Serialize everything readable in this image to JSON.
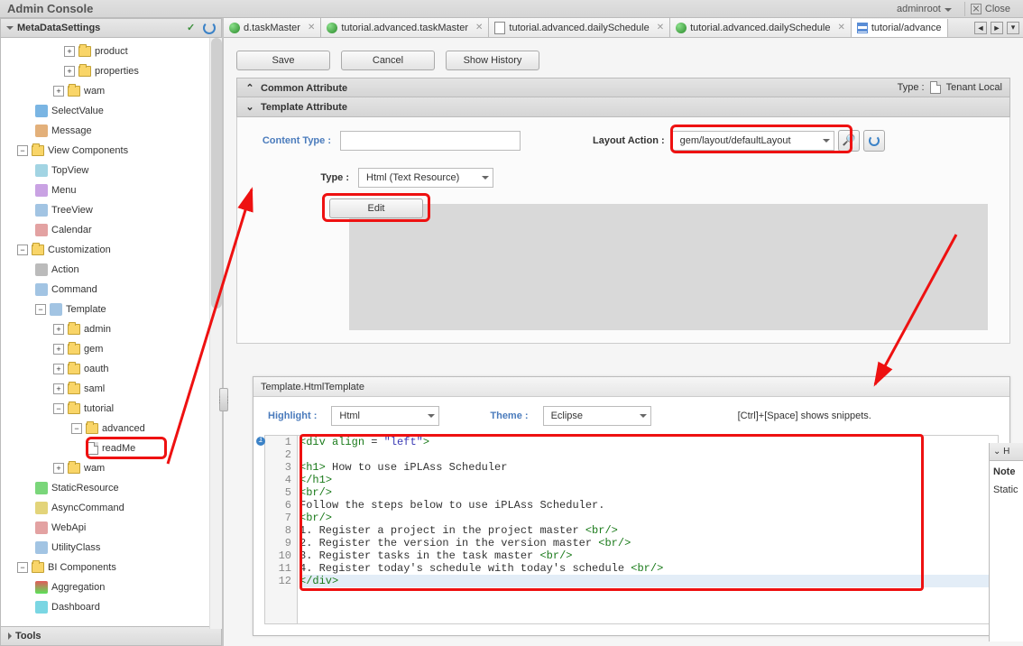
{
  "header": {
    "title": "Admin Console",
    "user": "adminroot",
    "close": "Close"
  },
  "sidebar": {
    "panel_title": "MetaDataSettings",
    "tools_title": "Tools",
    "tree": {
      "product": "product",
      "properties": "properties",
      "wam": "wam",
      "selectValue": "SelectValue",
      "message": "Message",
      "viewComponents": "View Components",
      "topView": "TopView",
      "menu": "Menu",
      "treeView": "TreeView",
      "calendar": "Calendar",
      "customization": "Customization",
      "action": "Action",
      "command": "Command",
      "template": "Template",
      "admin": "admin",
      "gem": "gem",
      "oauth": "oauth",
      "saml": "saml",
      "tutorial": "tutorial",
      "advanced": "advanced",
      "readMe": "readMe",
      "wam2": "wam",
      "staticResource": "StaticResource",
      "asyncCommand": "AsyncCommand",
      "webApi": "WebApi",
      "utilityClass": "UtilityClass",
      "biComponents": "BI Components",
      "aggregation": "Aggregation",
      "dashboard": "Dashboard"
    }
  },
  "tabs": [
    {
      "label": "d.taskMaster",
      "kind": "green"
    },
    {
      "label": "tutorial.advanced.taskMaster",
      "kind": "green"
    },
    {
      "label": "tutorial.advanced.dailySchedule",
      "kind": "file"
    },
    {
      "label": "tutorial.advanced.dailySchedule",
      "kind": "green"
    },
    {
      "label": "tutorial/advance",
      "kind": "grid"
    }
  ],
  "buttons": {
    "save": "Save",
    "cancel": "Cancel",
    "history": "Show History",
    "edit": "Edit"
  },
  "sections": {
    "common": "Common Attribute",
    "template": "Template Attribute",
    "typeLabel": "Type :",
    "tenantLocal": "Tenant Local"
  },
  "form": {
    "contentType": "Content Type :",
    "layoutAction": "Layout Action :",
    "layoutValue": "gem/layout/defaultLayout",
    "typeLabel": "Type :",
    "typeValue": "Html (Text Resource)"
  },
  "editor": {
    "title": "Template.HtmlTemplate",
    "highlight_label": "Highlight :",
    "highlight_value": "Html",
    "theme_label": "Theme :",
    "theme_value": "Eclipse",
    "hint": "[Ctrl]+[Space] shows snippets.",
    "code": [
      "<div align = \"left\">",
      "",
      "<h1> How to use iPLAss Scheduler",
      "</h1>",
      "<br/>",
      "Follow the steps below to use iPLAss Scheduler.",
      "<br/>",
      "1. Register a project in the project master <br/>",
      "2. Register the version in the version master <br/>",
      "3. Register tasks in the task master <br/>",
      "4. Register today's schedule with today's schedule <br/>",
      "</div>"
    ]
  },
  "snippet": {
    "head": "H",
    "note": "Note",
    "static": "Static"
  }
}
